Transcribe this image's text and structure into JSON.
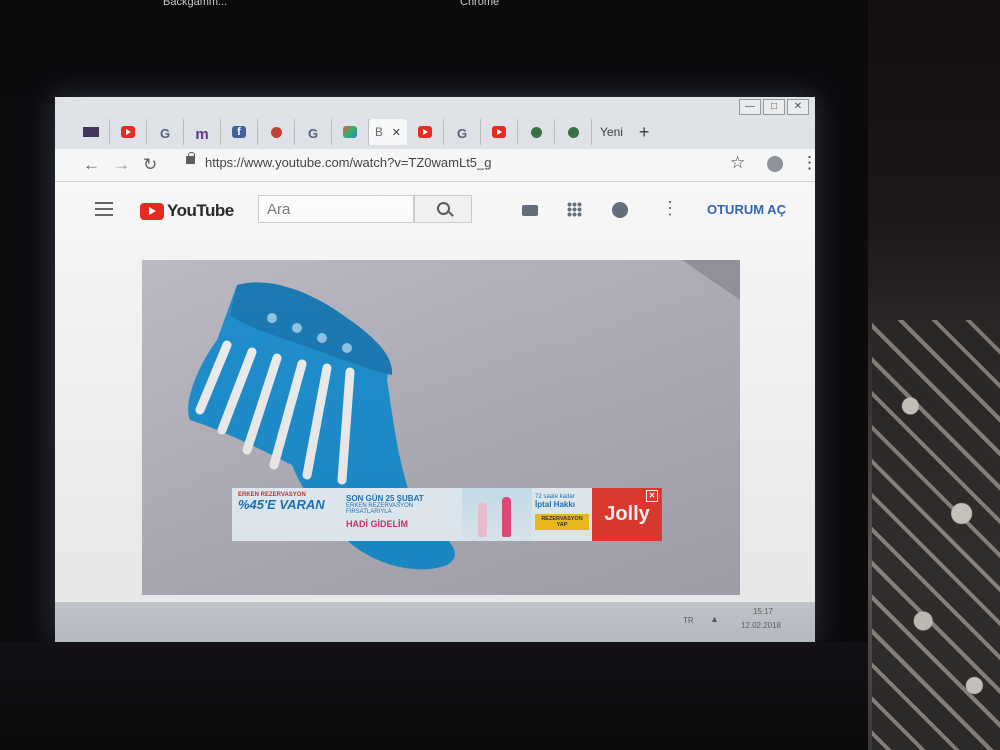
{
  "desktop": {
    "top_label_left": "Backgamm...",
    "top_label_right": "Chrome"
  },
  "browser": {
    "tabs": [
      {
        "icon": "flag-icon"
      },
      {
        "icon": "youtube-icon"
      },
      {
        "icon": "google-icon",
        "text": "G"
      },
      {
        "icon": "m-site-icon",
        "text": "m"
      },
      {
        "icon": "facebook-icon",
        "text": "f"
      },
      {
        "icon": "ladybug-icon"
      },
      {
        "icon": "google-icon",
        "text": "G"
      },
      {
        "icon": "colorful-site-icon"
      },
      {
        "icon": "b-site-icon",
        "text": "B",
        "active": true
      },
      {
        "icon": "youtube-icon"
      },
      {
        "icon": "google-icon",
        "text": "G"
      },
      {
        "icon": "youtube-icon"
      },
      {
        "icon": "turtle-icon"
      },
      {
        "icon": "turtle-icon"
      }
    ],
    "active_tab_close": "✕",
    "new_tab_label": "Yeni",
    "new_tab_button": "+",
    "window_controls": {
      "min": "—",
      "max": "□",
      "close": "✕"
    },
    "nav": {
      "back": "←",
      "forward": "→",
      "reload": "↻"
    },
    "address": "https://www.youtube.com/watch?v=TZ0wamLt5_g",
    "star": "☆",
    "menu": "⋮"
  },
  "youtube": {
    "logo_text": "YouTube",
    "search_placeholder": "Ara",
    "more": "⋮",
    "signin_label": "OTURUM AÇ"
  },
  "ad": {
    "small_top": "ERKEN REZERVASYON",
    "big_text": "%45'E VARAN",
    "mid_line1": "SON GÜN 25 ŞUBAT",
    "mid_line2": "ERKEN REZERVASYON FIRSATLARIYLA",
    "mid_line3": "HADİ GİDELİM",
    "right_line1": "72 saate kadar",
    "right_line2": "İptal Hakkı",
    "right_button": "REZERVASYON YAP",
    "brand": "Jolly",
    "close": "✕",
    "brand_color": "#e63a2e"
  },
  "taskbar": {
    "lang": "TR",
    "arrow": "▲",
    "time": "15:17",
    "date": "12.02.2018"
  },
  "colors": {
    "youtube_red": "#e62117",
    "sock_blue": "#1a8fd0",
    "signin_blue": "#2b5fb4"
  }
}
